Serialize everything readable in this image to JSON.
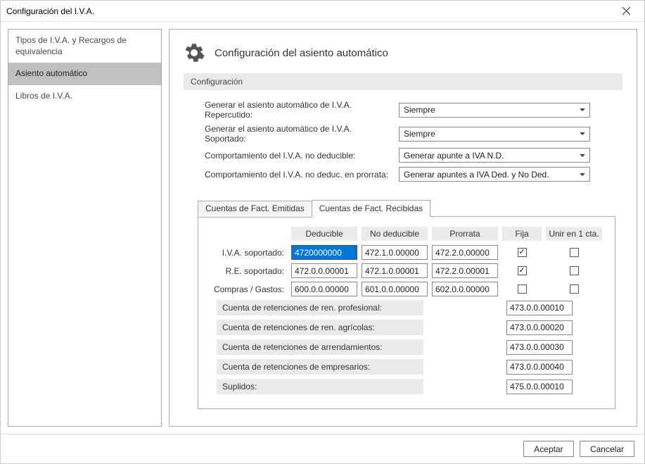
{
  "window": {
    "title": "Configuración del I.V.A."
  },
  "sidebar": {
    "items": [
      {
        "label": "Tipos de I.V.A. y Recargos de equivalencia",
        "selected": false
      },
      {
        "label": "Asiento automático",
        "selected": true
      },
      {
        "label": "Libros de I.V.A.",
        "selected": false
      }
    ]
  },
  "main": {
    "header": "Configuración del asiento automático",
    "section": "Configuración",
    "config": [
      {
        "label": "Generar el asiento automático de I.V.A. Repercutido:",
        "value": "Siempre"
      },
      {
        "label": "Generar el asiento automático de I.V.A. Soportado:",
        "value": "Siempre"
      },
      {
        "label": "Comportamiento del I.V.A. no deducible:",
        "value": "Generar apunte a IVA N.D."
      },
      {
        "label": "Comportamiento del I.V.A. no deduc. en prorrata:",
        "value": "Generar apuntes a IVA Ded. y No Ded."
      }
    ],
    "tabs": [
      {
        "label": "Cuentas de Fact. Emitidas",
        "active": false
      },
      {
        "label": "Cuentas de Fact. Recibidas",
        "active": true
      }
    ],
    "grid": {
      "headers": {
        "deducible": "Deducible",
        "nodeducible": "No deducible",
        "prorrata": "Prorrata",
        "fija": "Fija",
        "unir": "Unir en 1 cta."
      },
      "rows": [
        {
          "label": "I.V.A. soportado:",
          "ded": "4720000000",
          "ded_selected": true,
          "noded": "472.1.0.00000",
          "pro": "472.2.0.00000",
          "fija": true,
          "unir": false
        },
        {
          "label": "R.E. soportado:",
          "ded": "472.0.0.00001",
          "ded_selected": false,
          "noded": "472.1.0.00001",
          "pro": "472.2.0.00001",
          "fija": true,
          "unir": false
        },
        {
          "label": "Compras / Gastos:",
          "ded": "600.0.0.00000",
          "ded_selected": false,
          "noded": "601.0.0.00000",
          "pro": "602.0.0.00000",
          "fija": false,
          "unir": false
        }
      ],
      "long_rows": [
        {
          "label": "Cuenta de retenciones de ren. profesional:",
          "value": "473.0.0.00010"
        },
        {
          "label": "Cuenta de retenciones de ren. agrícolas:",
          "value": "473.0.0.00020"
        },
        {
          "label": "Cuenta de retenciones de arrendamientos:",
          "value": "473.0.0.00030"
        },
        {
          "label": "Cuenta de retenciones de empresarios:",
          "value": "473.0.0.00040"
        },
        {
          "label": "Suplidos:",
          "value": "475.0.0.00010"
        }
      ]
    }
  },
  "footer": {
    "accept": "Aceptar",
    "cancel": "Cancelar"
  }
}
